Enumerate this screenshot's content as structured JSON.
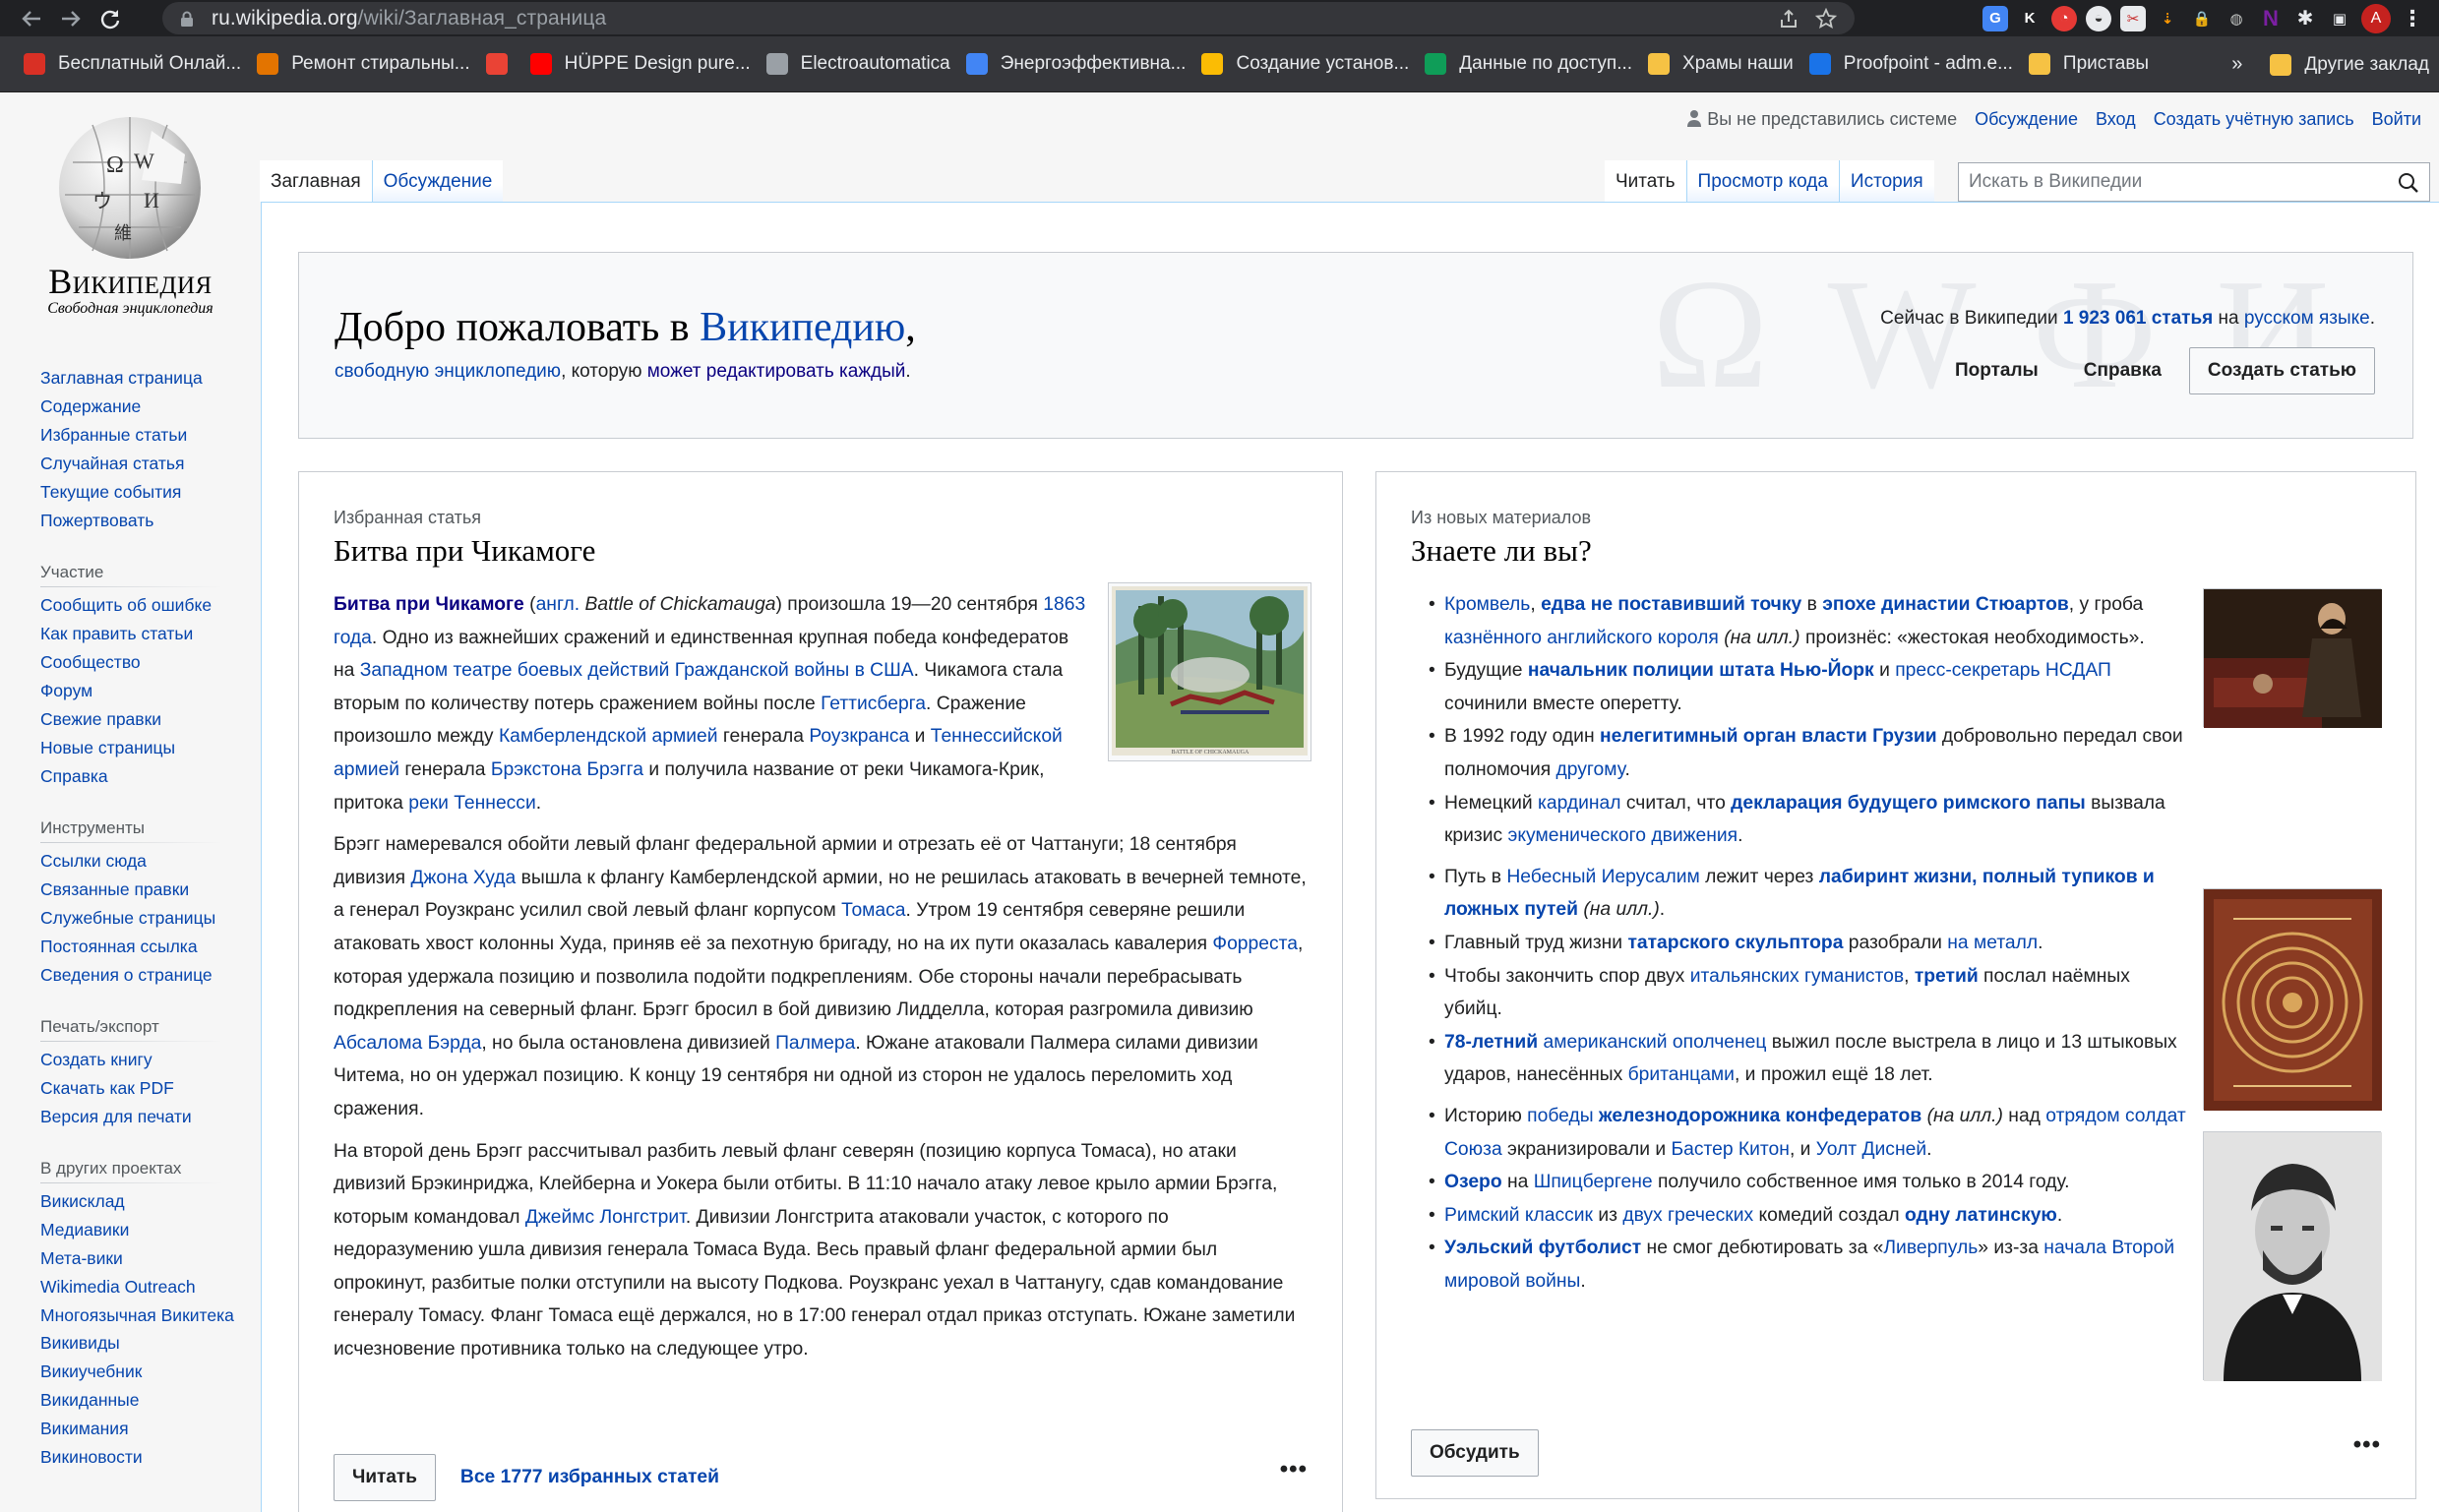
{
  "browser": {
    "url_host": "ru.wikipedia.org",
    "url_path": "/wiki/Заглавная_страница",
    "avatar_letter": "A",
    "bookmarks": [
      {
        "label": "Бесплатный Онлай...",
        "color": "#d93025"
      },
      {
        "label": "Ремонт стиральны...",
        "color": "#e37400"
      },
      {
        "label": "",
        "color": "#ea4335"
      },
      {
        "label": "HÜPPE Design pure...",
        "color": "#ff0000"
      },
      {
        "label": "Electroautomatica",
        "color": "#9aa0a6"
      },
      {
        "label": "Энергоэффективна...",
        "color": "#4285f4"
      },
      {
        "label": "Создание установ...",
        "color": "#fbbc04"
      },
      {
        "label": "Данные по доступ...",
        "color": "#0f9d58"
      },
      {
        "label": "Храмы наши",
        "color": "#f6c244"
      },
      {
        "label": "Proofpoint - adm.e...",
        "color": "#1a73e8"
      },
      {
        "label": "Приставы",
        "color": "#f6c244"
      }
    ],
    "other_bookmarks": "Другие заклад"
  },
  "wiki": {
    "site_name": "Википедия",
    "site_tagline": "Свободная энциклопедия",
    "user_links": {
      "not_logged": "Вы не представились системе",
      "talk": "Обсуждение",
      "login": "Вход",
      "create": "Создать учётную запись",
      "logout": "Войти"
    },
    "tabs_left": [
      "Заглавная",
      "Обсуждение"
    ],
    "tabs_right": [
      "Читать",
      "Просмотр кода",
      "История"
    ],
    "search_placeholder": "Искать в Википедии",
    "nav_main": [
      "Заглавная страница",
      "Содержание",
      "Избранные статьи",
      "Случайная статья",
      "Текущие события",
      "Пожертвовать"
    ],
    "nav_groups": [
      {
        "title": "Участие",
        "items": [
          "Сообщить об ошибке",
          "Как править статьи",
          "Сообщество",
          "Форум",
          "Свежие правки",
          "Новые страницы",
          "Справка"
        ]
      },
      {
        "title": "Инструменты",
        "items": [
          "Ссылки сюда",
          "Связанные правки",
          "Служебные страницы",
          "Постоянная ссылка",
          "Сведения о странице"
        ]
      },
      {
        "title": "Печать/экспорт",
        "items": [
          "Создать книгу",
          "Скачать как PDF",
          "Версия для печати"
        ]
      },
      {
        "title": "В других проектах",
        "items": [
          "Викисклад",
          "Медиавики",
          "Мета-вики",
          "Wikimedia Outreach",
          "Многоязычная Викитека",
          "Викивиды",
          "Викиучебник",
          "Викиданные",
          "Викимания",
          "Викиновости"
        ]
      }
    ]
  },
  "welcome": {
    "heading_prefix": "Добро пожаловать в ",
    "heading_link": "Википедию",
    "heading_suffix": ",",
    "sub_link1": "свободную энциклопедию",
    "sub_mid": ", которую ",
    "sub_link2": "может редактировать каждый",
    "sub_end": ".",
    "stat_prefix": "Сейчас в Википедии ",
    "stat_count": "1 923 061 статья",
    "stat_mid": " на ",
    "stat_lang": "русском языке",
    "stat_end": ".",
    "portals": "Порталы",
    "help": "Справка",
    "create_article": "Создать статью"
  },
  "featured": {
    "kicker": "Избранная статья",
    "title": "Битва при Чикамоге",
    "read_button": "Читать",
    "all_link": "Все 1777 избранных статей",
    "more": "•••",
    "paragraphs": [
      [
        {
          "t": "Битва при Чикамоге",
          "b": true
        },
        {
          "t": " ("
        },
        {
          "t": "англ.",
          "a": true
        },
        {
          "t": " "
        },
        {
          "t": "Battle of Chickamauga",
          "i": true
        },
        {
          "t": ") произошла 19—20 сентября "
        },
        {
          "t": "1863 года",
          "a": true
        },
        {
          "t": ". Одно из важнейших сражений и единственная крупная победа конфедератов на "
        },
        {
          "t": "Западном театре боевых действий Гражданской войны в США",
          "a": true
        },
        {
          "t": ". Чикамога стала вторым по количеству потерь сражением войны после "
        },
        {
          "t": "Геттисберга",
          "a": true
        },
        {
          "t": ". Сражение произошло между "
        },
        {
          "t": "Камберлендской армией",
          "a": true
        },
        {
          "t": " генерала "
        },
        {
          "t": "Роузкранса",
          "a": true
        },
        {
          "t": " и "
        },
        {
          "t": "Теннессийской армией",
          "a": true
        },
        {
          "t": " генерала "
        },
        {
          "t": "Брэкстона Брэгга",
          "a": true
        },
        {
          "t": " и получила название от реки Чикамога-Крик, притока "
        },
        {
          "t": "реки Теннесси",
          "a": true
        },
        {
          "t": "."
        }
      ],
      [
        {
          "t": "Брэгг намеревался обойти левый фланг федеральной армии и отрезать её от Чаттануги; 18 сентября дивизия "
        },
        {
          "t": "Джона Худа",
          "a": true
        },
        {
          "t": " вышла к флангу Камберлендской армии, но не решилась атаковать в вечерней темноте, а генерал Роузкранс усилил свой левый фланг корпусом "
        },
        {
          "t": "Томаса",
          "a": true
        },
        {
          "t": ". Утром 19 сентября северяне решили атаковать хвост колонны Худа, приняв её за пехотную бригаду, но на их пути оказалась кавалерия "
        },
        {
          "t": "Форреста",
          "a": true
        },
        {
          "t": ", которая удержала позицию и позволила подойти подкреплениям. Обе стороны начали перебрасывать подкрепления на северный фланг. Брэгг бросил в бой дивизию Лидделла, которая разгромила дивизию "
        },
        {
          "t": "Абсалома Бэрда",
          "a": true
        },
        {
          "t": ", но была остановлена дивизией "
        },
        {
          "t": "Палмера",
          "a": true
        },
        {
          "t": ". Южане атаковали Палмера силами дивизии Читема, но он удержал позицию. К концу 19 сентября ни одной из сторон не удалось переломить ход сражения."
        }
      ],
      [
        {
          "t": "На второй день Брэгг рассчитывал разбить левый фланг северян (позицию корпуса Томаса), но атаки дивизий Брэкинриджа, Клейберна и Уокера были отбиты. В 11:10 начало атаку левое крыло армии Брэгга, которым командовал "
        },
        {
          "t": "Джеймс Лонгстрит",
          "a": true
        },
        {
          "t": ". Дивизии Лонгстрита атаковали участок, с которого по недоразумению ушла дивизия генерала Томаса Вуда. Весь правый фланг федеральной армии был опрокинут, разбитые полки отступили на высоту Подкова. Роузкранс уехал в Чаттанугу, сдав командование генералу Томасу. Фланг Томаса ещё держался, но в 17:00 генерал отдал приказ отступать. Южане заметили исчезновение противника только на следующее утро."
        }
      ]
    ]
  },
  "dyk": {
    "kicker": "Из новых материалов",
    "title": "Знаете ли вы?",
    "discuss_button": "Обсудить",
    "more": "•••",
    "items": [
      {
        "gap": false,
        "parts": [
          {
            "t": "Кромвель",
            "a": true
          },
          {
            "t": ", "
          },
          {
            "t": "едва не поставивший точку",
            "a": true,
            "b": true
          },
          {
            "t": " в "
          },
          {
            "t": "эпохе династии Стюартов",
            "a": true,
            "b": true
          },
          {
            "t": ", у гроба "
          },
          {
            "t": "казнённого английского короля",
            "a": true
          },
          {
            "t": " "
          },
          {
            "t": "(на илл.)",
            "i": true
          },
          {
            "t": " произнёс: «жестокая необходимость»."
          }
        ]
      },
      {
        "gap": false,
        "parts": [
          {
            "t": "Будущие "
          },
          {
            "t": "начальник полиции штата Нью-Йорк",
            "a": true,
            "b": true
          },
          {
            "t": " и "
          },
          {
            "t": "пресс-секретарь НСДАП",
            "a": true
          },
          {
            "t": " сочинили вместе оперетту."
          }
        ]
      },
      {
        "gap": false,
        "parts": [
          {
            "t": "В 1992 году один "
          },
          {
            "t": "нелегитимный орган власти Грузии",
            "a": true,
            "b": true
          },
          {
            "t": " добровольно передал свои полномочия "
          },
          {
            "t": "другому",
            "a": true
          },
          {
            "t": "."
          }
        ]
      },
      {
        "gap": false,
        "parts": [
          {
            "t": "Немецкий "
          },
          {
            "t": "кардинал",
            "a": true
          },
          {
            "t": " считал, что "
          },
          {
            "t": "декларация будущего римского папы",
            "a": true,
            "b": true
          },
          {
            "t": " вызвала кризис "
          },
          {
            "t": "экуменического движения",
            "a": true
          },
          {
            "t": "."
          }
        ]
      },
      {
        "gap": true,
        "parts": [
          {
            "t": "Путь в "
          },
          {
            "t": "Небесный Иерусалим",
            "a": true
          },
          {
            "t": " лежит через "
          },
          {
            "t": "лабиринт жизни, полный тупиков и ложных путей",
            "a": true,
            "b": true
          },
          {
            "t": " "
          },
          {
            "t": "(на илл.)",
            "i": true
          },
          {
            "t": "."
          }
        ]
      },
      {
        "gap": false,
        "parts": [
          {
            "t": "Главный труд жизни "
          },
          {
            "t": "татарского скульптора",
            "a": true,
            "b": true
          },
          {
            "t": " разобрали "
          },
          {
            "t": "на металл",
            "a": true
          },
          {
            "t": "."
          }
        ]
      },
      {
        "gap": false,
        "parts": [
          {
            "t": "Чтобы закончить спор двух "
          },
          {
            "t": "итальянских гуманистов",
            "a": true
          },
          {
            "t": ", "
          },
          {
            "t": "третий",
            "a": true,
            "b": true
          },
          {
            "t": " послал наёмных убийц."
          }
        ]
      },
      {
        "gap": false,
        "parts": [
          {
            "t": "78-летний",
            "a": true,
            "b": true
          },
          {
            "t": " "
          },
          {
            "t": "американский ополченец",
            "a": true
          },
          {
            "t": " выжил после выстрела в лицо и 13 штыковых ударов, нанесённых "
          },
          {
            "t": "британцами",
            "a": true
          },
          {
            "t": ", и прожил ещё 18 лет."
          }
        ]
      },
      {
        "gap": true,
        "parts": [
          {
            "t": "Историю "
          },
          {
            "t": "победы ",
            "a": true
          },
          {
            "t": "железнодорожника конфедератов",
            "a": true,
            "b": true
          },
          {
            "t": " "
          },
          {
            "t": "(на илл.)",
            "i": true
          },
          {
            "t": " над "
          },
          {
            "t": "отрядом солдат Союза",
            "a": true
          },
          {
            "t": " экранизировали и "
          },
          {
            "t": "Бастер Китон",
            "a": true
          },
          {
            "t": ", и "
          },
          {
            "t": "Уолт Дисней",
            "a": true
          },
          {
            "t": "."
          }
        ]
      },
      {
        "gap": false,
        "parts": [
          {
            "t": "Озеро",
            "a": true,
            "b": true
          },
          {
            "t": " на "
          },
          {
            "t": "Шпицбергене",
            "a": true
          },
          {
            "t": " получило собственное имя только в 2014 году."
          }
        ]
      },
      {
        "gap": false,
        "parts": [
          {
            "t": "Римский классик",
            "a": true
          },
          {
            "t": " из "
          },
          {
            "t": "двух греческих",
            "a": true
          },
          {
            "t": " комедий создал "
          },
          {
            "t": "одну латинскую",
            "a": true,
            "b": true
          },
          {
            "t": "."
          }
        ]
      },
      {
        "gap": false,
        "parts": [
          {
            "t": "Уэльский футболист",
            "a": true,
            "b": true
          },
          {
            "t": " не смог дебютировать за «"
          },
          {
            "t": "Ливерпуль",
            "a": true
          },
          {
            "t": "» из-за "
          },
          {
            "t": "начала Второй мировой войны",
            "a": true
          },
          {
            "t": "."
          }
        ]
      }
    ]
  }
}
